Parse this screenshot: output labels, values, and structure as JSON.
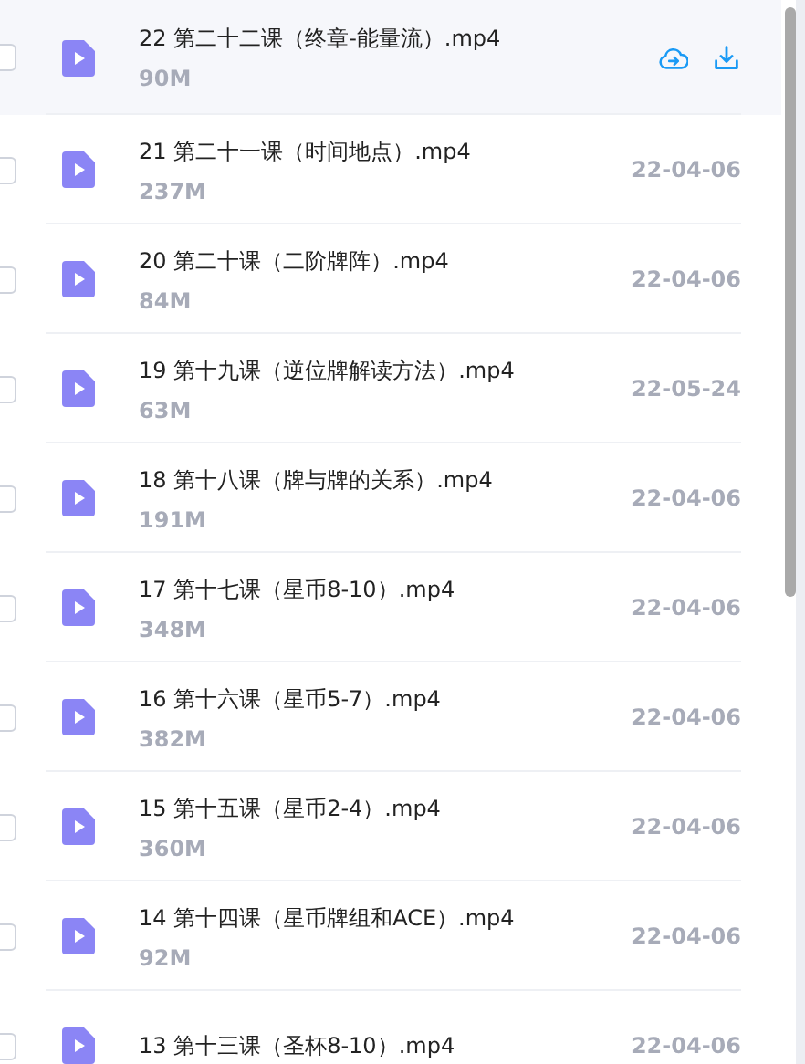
{
  "files": [
    {
      "name": "22 第二十二课（终章-能量流）.mp4",
      "size": "90M",
      "hovered": true,
      "checked": false
    },
    {
      "name": "21 第二十一课（时间地点）.mp4",
      "size": "237M",
      "date": "22-04-06",
      "hovered": false,
      "checked": false
    },
    {
      "name": "20 第二十课（二阶牌阵）.mp4",
      "size": "84M",
      "date": "22-04-06",
      "hovered": false,
      "checked": false
    },
    {
      "name": "19 第十九课（逆位牌解读方法）.mp4",
      "size": "63M",
      "date": "22-05-24",
      "hovered": false,
      "checked": false
    },
    {
      "name": "18 第十八课（牌与牌的关系）.mp4",
      "size": "191M",
      "date": "22-04-06",
      "hovered": false,
      "checked": false
    },
    {
      "name": "17 第十七课（星币8-10）.mp4",
      "size": "348M",
      "date": "22-04-06",
      "hovered": false,
      "checked": false
    },
    {
      "name": "16 第十六课（星币5-7）.mp4",
      "size": "382M",
      "date": "22-04-06",
      "hovered": false,
      "checked": false
    },
    {
      "name": "15 第十五课（星币2-4）.mp4",
      "size": "360M",
      "date": "22-04-06",
      "hovered": false,
      "checked": false
    },
    {
      "name": "14 第十四课（星币牌组和ACE）.mp4",
      "size": "92M",
      "date": "22-04-06",
      "hovered": false,
      "checked": false
    },
    {
      "name": "13 第十三课（圣杯8-10）.mp4",
      "date": "22-04-06",
      "hovered": false,
      "checked": false
    }
  ]
}
